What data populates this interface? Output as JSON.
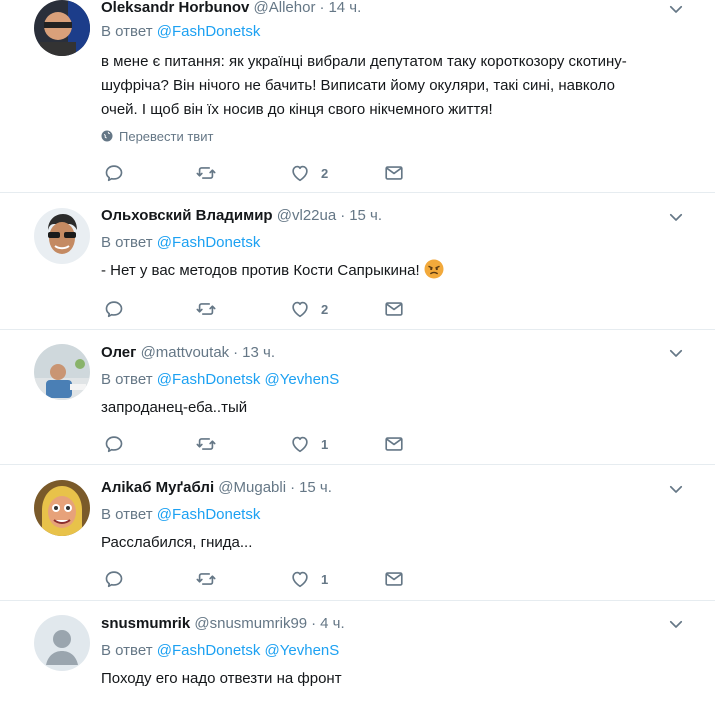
{
  "labels": {
    "reply_prefix": "В ответ",
    "translate": "Перевести твит",
    "dot": "·"
  },
  "colors": {
    "link": "#1da1f2",
    "secondary": "#657786",
    "divider": "#e6ecf0"
  },
  "tweets": [
    {
      "name": "Oleksandr Horbunov",
      "handle": "@Allehor",
      "time": "14 ч.",
      "reply_to": [
        "@FashDonetsk"
      ],
      "text_lines": [
        "в мене є питання: як українці вибрали депутатом таку короткозору скотину-",
        "шуфріча? Він нічого не бачить! Виписати йому окуляри, такі сині, навколо",
        "очей. І щоб він їх носив до кінця свого нікчемного життя!"
      ],
      "likes": "2"
    },
    {
      "name": "Ольховский Владимир",
      "handle": "@vl22ua",
      "time": "15 ч.",
      "reply_to": [
        "@FashDonetsk"
      ],
      "text_lines": [
        "- Нет у вас методов против Кости Сапрыкина!"
      ],
      "emoji": "angry-face-emoji",
      "likes": "2"
    },
    {
      "name": "Олег",
      "handle": "@mattvoutak",
      "time": "13 ч.",
      "reply_to": [
        "@FashDonetsk",
        "@YevhenS"
      ],
      "text_lines": [
        "запроданец-еба..тый"
      ],
      "likes": "1"
    },
    {
      "name": "Аліkаб Муґаблі",
      "handle": "@Mugabli",
      "time": "15 ч.",
      "reply_to": [
        "@FashDonetsk"
      ],
      "text_lines": [
        "Расслабился, гнида..."
      ],
      "likes": "1"
    },
    {
      "name": "snusmumrik",
      "handle": "@snusmumrik99",
      "time": "4 ч.",
      "reply_to": [
        "@FashDonetsk",
        "@YevhenS"
      ],
      "text_lines": [
        "Походу его надо отвезти на фронт"
      ],
      "likes": ""
    }
  ]
}
